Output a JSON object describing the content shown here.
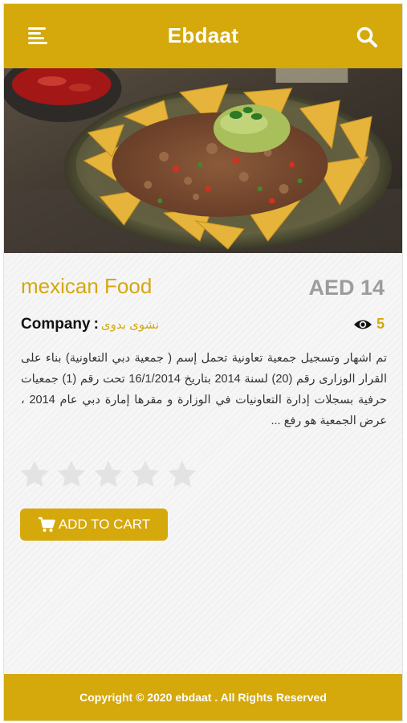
{
  "header": {
    "title": "Ebdaat",
    "menu_icon": "menu-icon",
    "search_icon": "search-icon"
  },
  "product": {
    "image_alt": "nachos",
    "title": "mexican Food",
    "price": "AED 14",
    "company_label": "Company",
    "company_separator": ":",
    "company_name": "نشوى بدوى",
    "views_icon": "eye-icon",
    "views_count": "5",
    "description": "تم اشهار وتسجيل جمعية تعاونية تحمل إسم ( جمعية دبي التعاونية) بناء على القرار الوزارى رقم (20) لسنة 2014 بتاريخ 16/1/2014 تحت رقم (1) جمعيات حرفية بسجلات إدارة التعاونيات في الوزارة و مقرها إمارة دبي عام 2014 ، عرض الجمعية هو رفع ...",
    "rating": 0,
    "rating_max": 5
  },
  "cart": {
    "button_label": "ADD TO CART",
    "icon": "cart-icon"
  },
  "footer": {
    "copyright": "Copyright © 2020 ebdaat . All Rights Reserved"
  },
  "colors": {
    "brand": "#d5a80c",
    "price": "#9c9c9c",
    "star_empty": "#e3e3e3"
  }
}
